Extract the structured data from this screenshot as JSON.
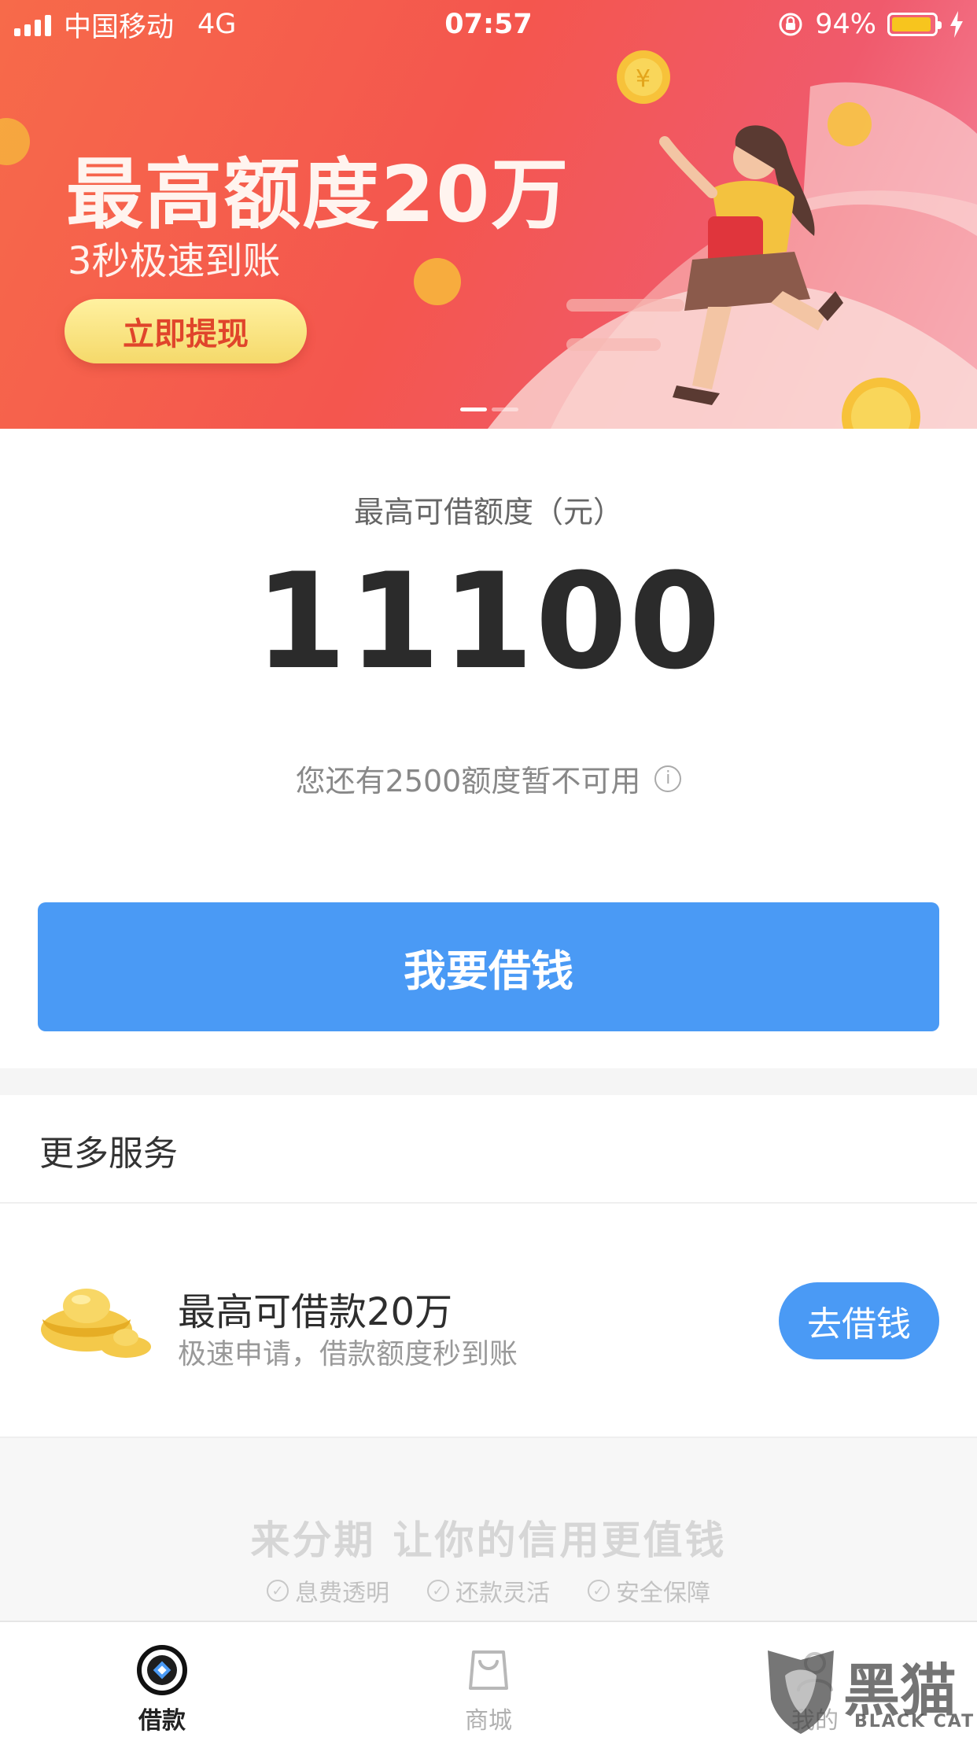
{
  "status_bar": {
    "carrier": "中国移动",
    "network": "4G",
    "time": "07:57",
    "battery": "94%",
    "battery_level": 0.94
  },
  "banner": {
    "title": "最高额度20万",
    "subtitle": "3秒极速到账",
    "cta_label": "立即提现",
    "page_count": 2,
    "active_page": 1
  },
  "credit": {
    "label": "最高可借额度（元）",
    "amount": "11100",
    "note": "您还有2500额度暂不可用",
    "info_icon": "i"
  },
  "borrow_button": "我要借钱",
  "services": {
    "title": "更多服务",
    "items": [
      {
        "title": "最高可借款20万",
        "desc": "极速申请，借款额度秒到账",
        "button": "去借钱",
        "icon": "gold-ingot-icon"
      }
    ]
  },
  "footer": {
    "slogan_left": "来分期",
    "slogan_right": "让你的信用更值钱",
    "features": [
      "息费透明",
      "还款灵活",
      "安全保障"
    ]
  },
  "tabbar": {
    "tabs": [
      {
        "label": "借款",
        "icon": "loan-icon",
        "active": true
      },
      {
        "label": "商城",
        "icon": "shop-bag-icon",
        "active": false
      },
      {
        "label": "我的",
        "icon": "profile-icon",
        "active": false
      }
    ]
  },
  "watermark": {
    "text": "黑猫",
    "latin": "BLACK CAT"
  },
  "colors": {
    "primary": "#4a9af5",
    "banner_start": "#f76a4a",
    "banner_end": "#f58aa2",
    "battery": "#f7c51e"
  }
}
